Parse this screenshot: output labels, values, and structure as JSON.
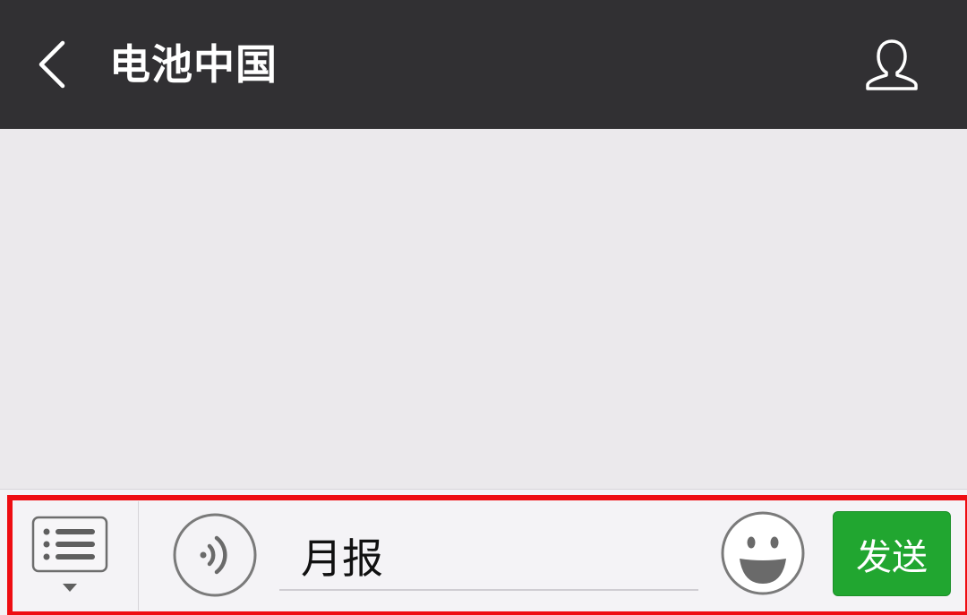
{
  "header": {
    "title": "电池中国",
    "back_icon": "chevron-left-icon",
    "profile_icon": "user-profile-icon"
  },
  "input_bar": {
    "menu_icon": "list-menu-icon",
    "voice_icon": "voice-input-icon",
    "message_value": "月报",
    "emoji_icon": "smiley-icon",
    "send_label": "发送"
  },
  "colors": {
    "header_bg": "#313033",
    "chat_bg": "#ebe9ec",
    "input_bar_bg": "#f4f3f6",
    "send_button": "#21a630",
    "highlight": "#ee0d12"
  }
}
